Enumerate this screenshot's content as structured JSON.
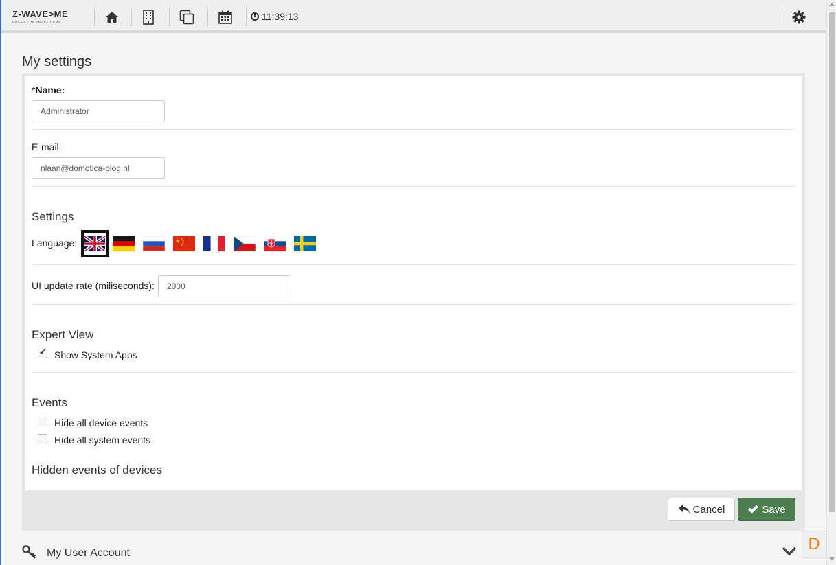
{
  "app": {
    "logo_text": "Z-WAVE>ME",
    "logo_tagline": "BUILDS THE SMART HOME",
    "time": "11:39:13"
  },
  "toolbar": {
    "icons": [
      "home-icon",
      "building-icon",
      "copy-icon",
      "calendar-icon",
      "clock-icon",
      "gear-icon"
    ]
  },
  "page": {
    "title": "My settings"
  },
  "form": {
    "name_required_mark": "*",
    "name_label": "Name:",
    "name_value": "Administrator",
    "email_label": "E-mail:",
    "email_value": "nlaan@domotica-blog.nl",
    "settings_heading": "Settings",
    "language_label": "Language:",
    "languages": [
      {
        "code": "en",
        "icon": "uk-flag-icon",
        "selected": true
      },
      {
        "code": "de",
        "icon": "germany-flag-icon",
        "selected": false
      },
      {
        "code": "ru",
        "icon": "russia-flag-icon",
        "selected": false
      },
      {
        "code": "cn",
        "icon": "china-flag-icon",
        "selected": false
      },
      {
        "code": "fr",
        "icon": "france-flag-icon",
        "selected": false
      },
      {
        "code": "cz",
        "icon": "czech-flag-icon",
        "selected": false
      },
      {
        "code": "sk",
        "icon": "slovakia-flag-icon",
        "selected": false
      },
      {
        "code": "se",
        "icon": "sweden-flag-icon",
        "selected": false
      }
    ],
    "ui_rate_label": "UI update rate (miliseconds):",
    "ui_rate_value": "2000",
    "expert_heading": "Expert View",
    "show_system_apps_label": "Show System Apps",
    "show_system_apps_checked": true,
    "events_heading": "Events",
    "hide_device_events_label": "Hide all device events",
    "hide_device_events_checked": false,
    "hide_system_events_label": "Hide all system events",
    "hide_system_events_checked": false,
    "hidden_events_heading": "Hidden events of devices"
  },
  "buttons": {
    "cancel_label": "Cancel",
    "save_label": "Save"
  },
  "account": {
    "label": "My User Account"
  },
  "badge": {
    "letter": "D"
  },
  "colors": {
    "save_green": "#4c7e4f",
    "badge_orange": "#f0851c",
    "edge_blue": "#3b73c4"
  }
}
